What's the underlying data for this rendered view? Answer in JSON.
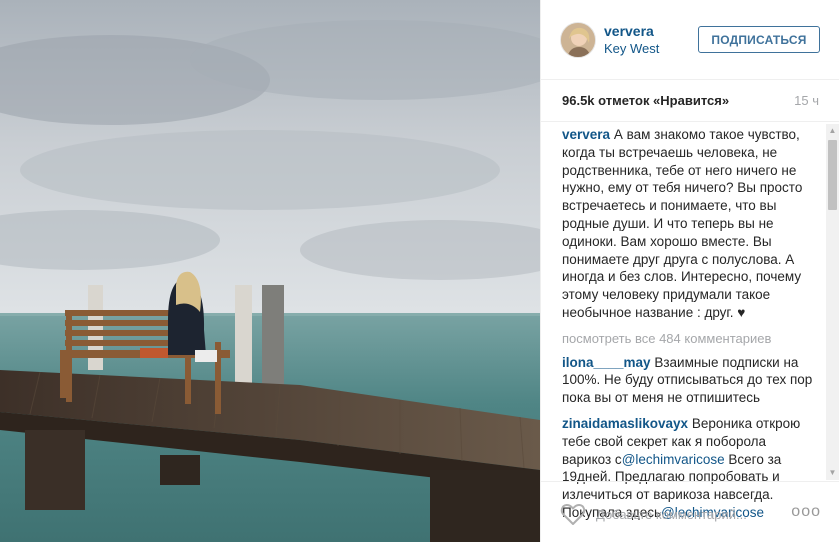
{
  "post": {
    "photo_alt": "",
    "colors": {
      "sky": "#c9ced3",
      "sea": "#5a8a8a",
      "pier": "#4b3a2c"
    }
  },
  "header": {
    "username": "ververa",
    "location": "Key West",
    "follow_label": "ПОДПИСАТЬСЯ"
  },
  "stats": {
    "likes": "96.5k отметок «Нравится»",
    "time": "15 ч"
  },
  "caption": {
    "user": "ververa",
    "text": "А вам знакомо такое чувство, когда ты встречаешь человека, не родственника, тебе от него ничего не нужно, ему от тебя ничего? Вы просто встречаетесь и понимаете, что вы родные души. И что теперь вы не одиноки. Вам хорошо вместе. Вы понимаете друг друга с полуслова. А иногда и без слов. Интересно, почему этому человеку придумали такое необычное название : друг. ♥"
  },
  "view_all": "посмотреть все 484 комментариев",
  "comments": [
    {
      "user": "ilona____may",
      "text": "Взаимные подписки на 100%. Не буду отписываться до тех пор пока вы от меня не отпишитесь"
    },
    {
      "user": "zinaidamaslikovayx",
      "text_1": "Вероника открою тебе свой секрет как я поборола варикоз с",
      "mention_1": "@lechimvaricose",
      "text_2": " Всего за 19дней. Предлагаю попробовать и излечиться от варикоза навсегда. Покупала здесь",
      "mention_2": "@lechimvaricose"
    }
  ],
  "footer": {
    "comment_placeholder": "Добавьте комментарий...",
    "more_label": "ooo"
  },
  "icons": [
    "heart-icon",
    "more-options-icon",
    "scroll-up-icon",
    "scroll-down-icon"
  ]
}
